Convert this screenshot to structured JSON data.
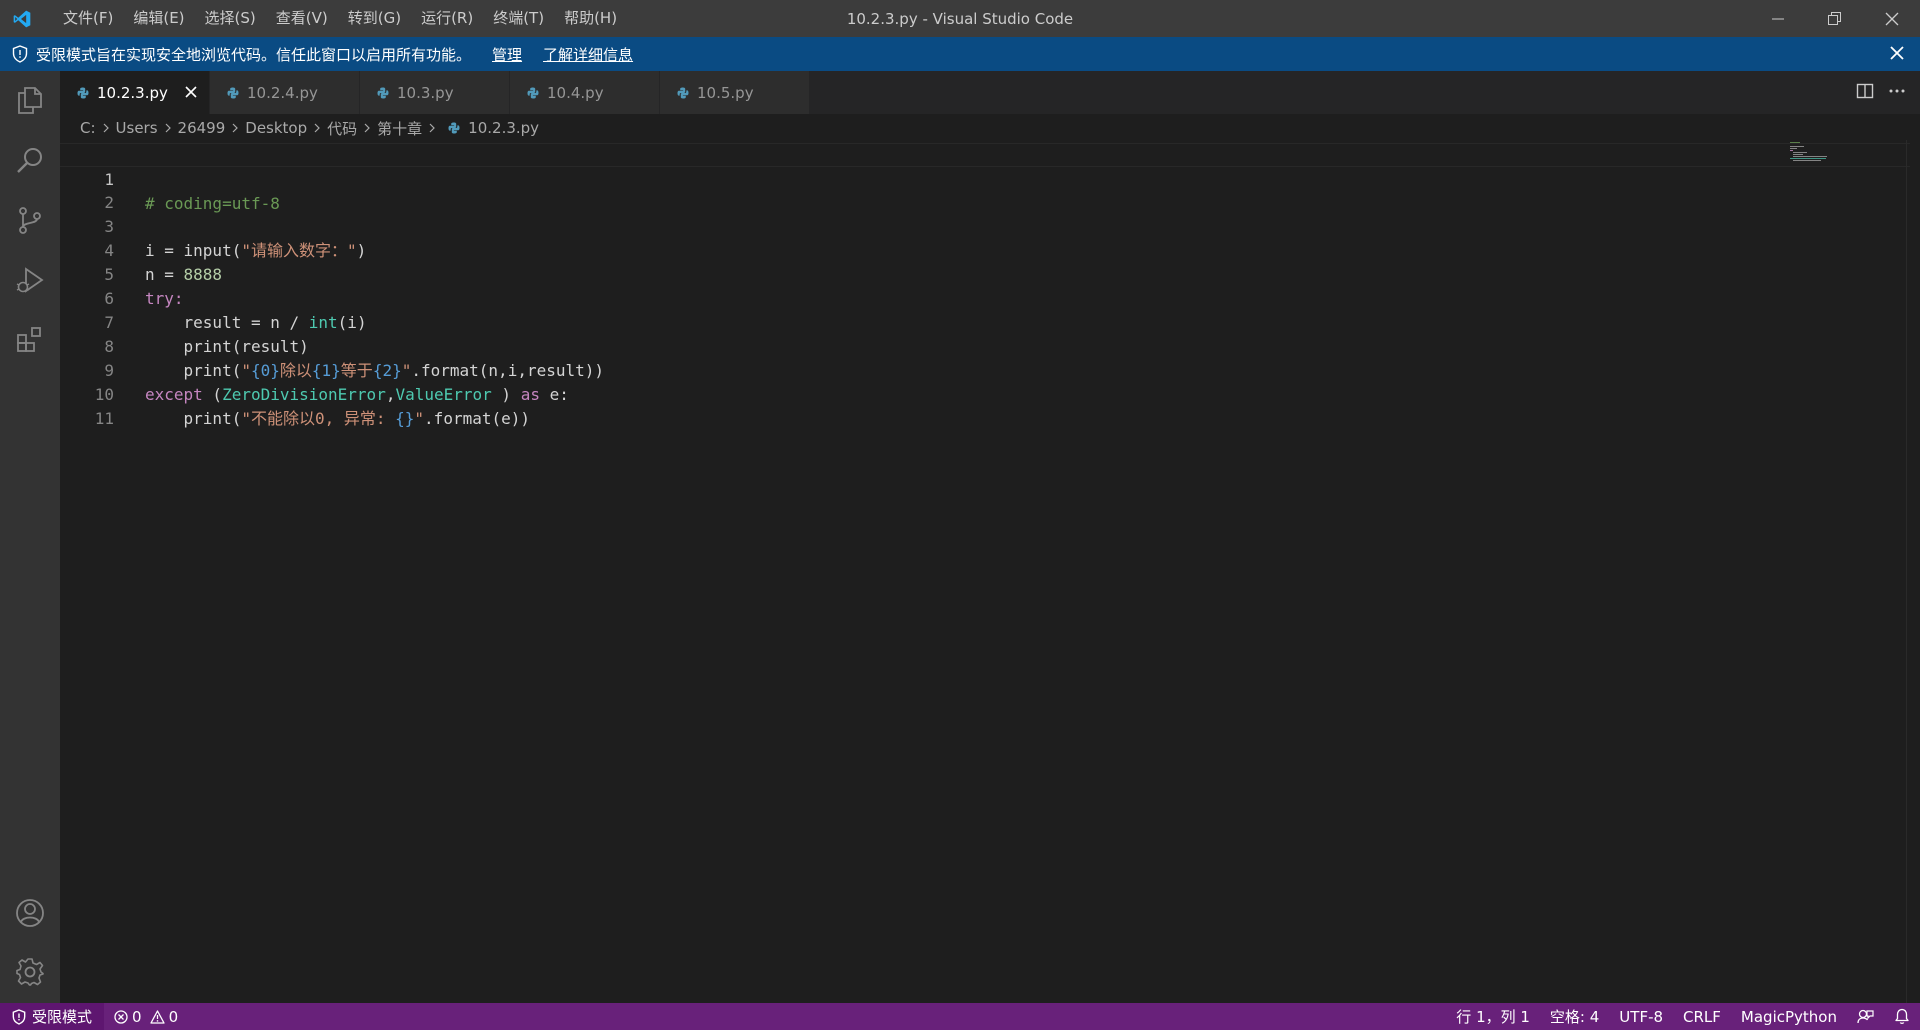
{
  "window": {
    "title": "10.2.3.py - Visual Studio Code",
    "menu": [
      "文件(F)",
      "编辑(E)",
      "选择(S)",
      "查看(V)",
      "转到(G)",
      "运行(R)",
      "终端(T)",
      "帮助(H)"
    ]
  },
  "banner": {
    "message": "受限模式旨在实现安全地浏览代码。信任此窗口以启用所有功能。",
    "manage": "管理",
    "learn_more": "了解详细信息"
  },
  "activity_icons": [
    "explorer-icon",
    "search-icon",
    "source-control-icon",
    "run-debug-icon",
    "extensions-icon",
    "account-icon",
    "settings-gear-icon"
  ],
  "tabs": [
    {
      "label": "10.2.3.py",
      "active": true
    },
    {
      "label": "10.2.4.py",
      "active": false
    },
    {
      "label": "10.3.py",
      "active": false
    },
    {
      "label": "10.4.py",
      "active": false
    },
    {
      "label": "10.5.py",
      "active": false
    }
  ],
  "breadcrumb": [
    "C:",
    "Users",
    "26499",
    "Desktop",
    "代码",
    "第十章",
    "10.2.3.py"
  ],
  "editor": {
    "line_numbers": [
      "1",
      "2",
      "3",
      "4",
      "5",
      "6",
      "7",
      "8",
      "9",
      "10",
      "11"
    ],
    "lines": [
      "# coding=utf-8",
      "",
      "i = input(\"请输入数字：\")",
      "n = 8888",
      "try:",
      "    result = n / int(i)",
      "    print(result)",
      "    print(\"{0}除以{1}等于{2}\".format(n,i,result))",
      "except (ZeroDivisionError,ValueError ) as e:",
      "    print(\"不能除以0, 异常: {}\".format(e))",
      ""
    ]
  },
  "colors": {
    "statusbar": "#68217a",
    "banner": "#0a4b83",
    "python_icon": "#519aba"
  },
  "status": {
    "restricted": "受限模式",
    "errors": "0",
    "warnings": "0",
    "position": "行 1，列 1",
    "spaces": "空格: 4",
    "encoding": "UTF-8",
    "eol": "CRLF",
    "language": "MagicPython"
  }
}
